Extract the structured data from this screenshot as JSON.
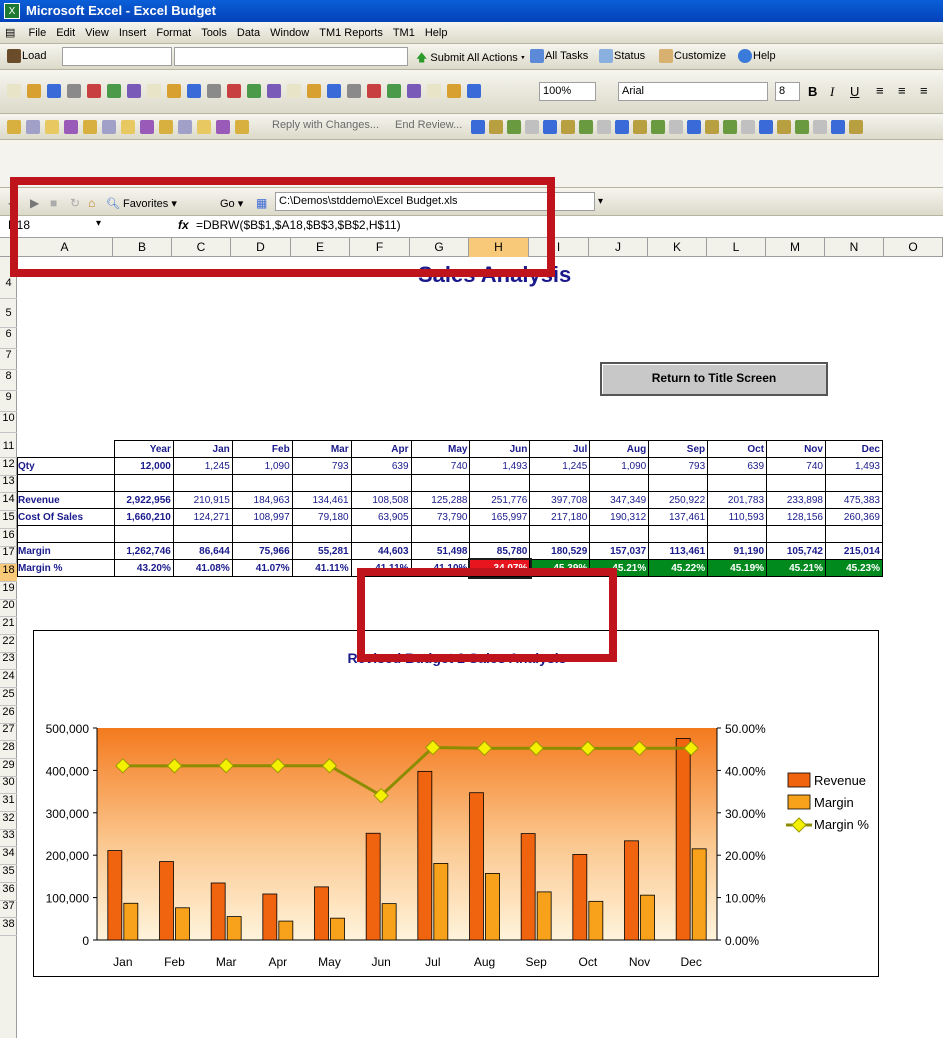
{
  "window": {
    "title": "Microsoft Excel - Excel Budget"
  },
  "menu": [
    "File",
    "Edit",
    "View",
    "Insert",
    "Format",
    "Tools",
    "Data",
    "Window",
    "TM1 Reports",
    "TM1",
    "Help"
  ],
  "tm1bar": {
    "load": "Load",
    "submit": "Submit All Actions",
    "alltasks": "All Tasks",
    "status": "Status",
    "customize": "Customize",
    "help": "Help"
  },
  "stdbar": {
    "zoom": "100%",
    "font": "Arial",
    "size": "8",
    "bold": "B",
    "italic": "I",
    "underline": "U"
  },
  "reviewbar": {
    "reply": "Reply with Changes...",
    "end": "End Review..."
  },
  "webbar": {
    "favorites": "Favorites",
    "go": "Go",
    "address": "C:\\Demos\\stddemo\\Excel Budget.xls"
  },
  "formula": {
    "cell": "H18",
    "fx": "fx",
    "text": "=DBRW($B$1,$A18,$B$3,$B$2,H$11)"
  },
  "columns": [
    "A",
    "B",
    "C",
    "D",
    "E",
    "F",
    "G",
    "H",
    "I",
    "J",
    "K",
    "L",
    "M",
    "N",
    "O"
  ],
  "rows": [
    "4",
    "5",
    "6",
    "7",
    "8",
    "9",
    "10",
    "11",
    "12",
    "13",
    "14",
    "15",
    "16",
    "17",
    "18",
    "19",
    "20",
    "21",
    "22",
    "23",
    "24",
    "25",
    "26",
    "27",
    "28",
    "29",
    "30",
    "31",
    "32",
    "33",
    "34",
    "35",
    "36",
    "37",
    "38"
  ],
  "sheet": {
    "title": "Sales Analysis",
    "return_button": "Return to Title Screen",
    "headers": [
      "Year",
      "Jan",
      "Feb",
      "Mar",
      "Apr",
      "May",
      "Jun",
      "Jul",
      "Aug",
      "Sep",
      "Oct",
      "Nov",
      "Dec"
    ],
    "qty": {
      "label": "Qty",
      "values": [
        "12,000",
        "1,245",
        "1,090",
        "793",
        "639",
        "740",
        "1,493",
        "1,245",
        "1,090",
        "793",
        "639",
        "740",
        "1,493"
      ]
    },
    "revenue": {
      "label": "Revenue",
      "values": [
        "2,922,956",
        "210,915",
        "184,963",
        "134,461",
        "108,508",
        "125,288",
        "251,776",
        "397,708",
        "347,349",
        "250,922",
        "201,783",
        "233,898",
        "475,383"
      ]
    },
    "cost": {
      "label": "Cost Of Sales",
      "values": [
        "1,660,210",
        "124,271",
        "108,997",
        "79,180",
        "63,905",
        "73,790",
        "165,997",
        "217,180",
        "190,312",
        "137,461",
        "110,593",
        "128,156",
        "260,369"
      ]
    },
    "margin": {
      "label": "Margin",
      "values": [
        "1,262,746",
        "86,644",
        "75,966",
        "55,281",
        "44,603",
        "51,498",
        "85,780",
        "180,529",
        "157,037",
        "113,461",
        "91,190",
        "105,742",
        "215,014"
      ]
    },
    "margin_pct": {
      "label": "Margin %",
      "values": [
        "43.20%",
        "41.08%",
        "41.07%",
        "41.11%",
        "41.11%",
        "41.10%",
        "34.07%",
        "45.39%",
        "45.21%",
        "45.22%",
        "45.19%",
        "45.21%",
        "45.23%"
      ]
    }
  },
  "colors": {
    "highlight_red": "#e8141e",
    "highlight_green": "#008a1e",
    "frame_red": "#c0141c"
  },
  "chart_data": {
    "type": "bar",
    "title": "Revised Budget 2 Sales Analysis",
    "categories": [
      "Jan",
      "Feb",
      "Mar",
      "Apr",
      "May",
      "Jun",
      "Jul",
      "Aug",
      "Sep",
      "Oct",
      "Nov",
      "Dec"
    ],
    "series": [
      {
        "name": "Revenue",
        "type": "bar",
        "axis": "left",
        "values": [
          210915,
          184963,
          134461,
          108508,
          125288,
          251776,
          397708,
          347349,
          250922,
          201783,
          233898,
          475383
        ]
      },
      {
        "name": "Margin",
        "type": "bar",
        "axis": "left",
        "values": [
          86644,
          75966,
          55281,
          44603,
          51498,
          85780,
          180529,
          157037,
          113461,
          91190,
          105742,
          215014
        ]
      },
      {
        "name": "Margin %",
        "type": "line",
        "axis": "right",
        "values": [
          41.08,
          41.07,
          41.11,
          41.11,
          41.1,
          34.07,
          45.39,
          45.21,
          45.22,
          45.19,
          45.21,
          45.23
        ]
      }
    ],
    "ylim": [
      0,
      500000
    ],
    "yticks": [
      "0",
      "100,000",
      "200,000",
      "300,000",
      "400,000",
      "500,000"
    ],
    "y2lim": [
      0,
      50
    ],
    "y2ticks": [
      "0.00%",
      "10.00%",
      "20.00%",
      "30.00%",
      "40.00%",
      "50.00%"
    ],
    "legend": "right",
    "colors": {
      "Revenue": "#f06410",
      "Margin": "#f7a21a",
      "Margin %": "#b5b800"
    }
  }
}
